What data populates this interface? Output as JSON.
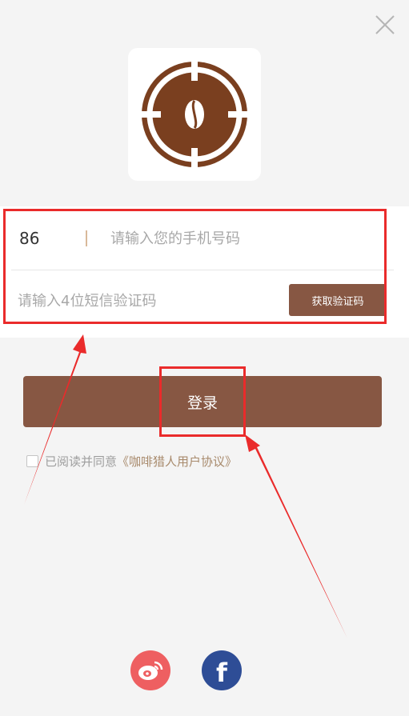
{
  "window": {
    "close_icon": "close-icon"
  },
  "logo": {
    "icon": "coffee-bean-target-icon",
    "color": "#7a3f1f"
  },
  "phone": {
    "country_code": "86",
    "placeholder": "请输入您的手机号码",
    "value": ""
  },
  "sms": {
    "placeholder": "请输入4位短信验证码",
    "value": "",
    "get_code_label": "获取验证码"
  },
  "login": {
    "label": "登录"
  },
  "agreement": {
    "checked": false,
    "prefix": "已阅读并同意",
    "link": "《咖啡猎人用户协议》"
  },
  "social": {
    "weibo_icon": "weibo-icon",
    "facebook_icon": "facebook-icon",
    "facebook_glyph": "f"
  },
  "colors": {
    "accent": "#875743",
    "annotation": "#ea2b2b",
    "link": "#a88a6c",
    "weibo": "#ee5f61",
    "facebook": "#2e4d96"
  }
}
